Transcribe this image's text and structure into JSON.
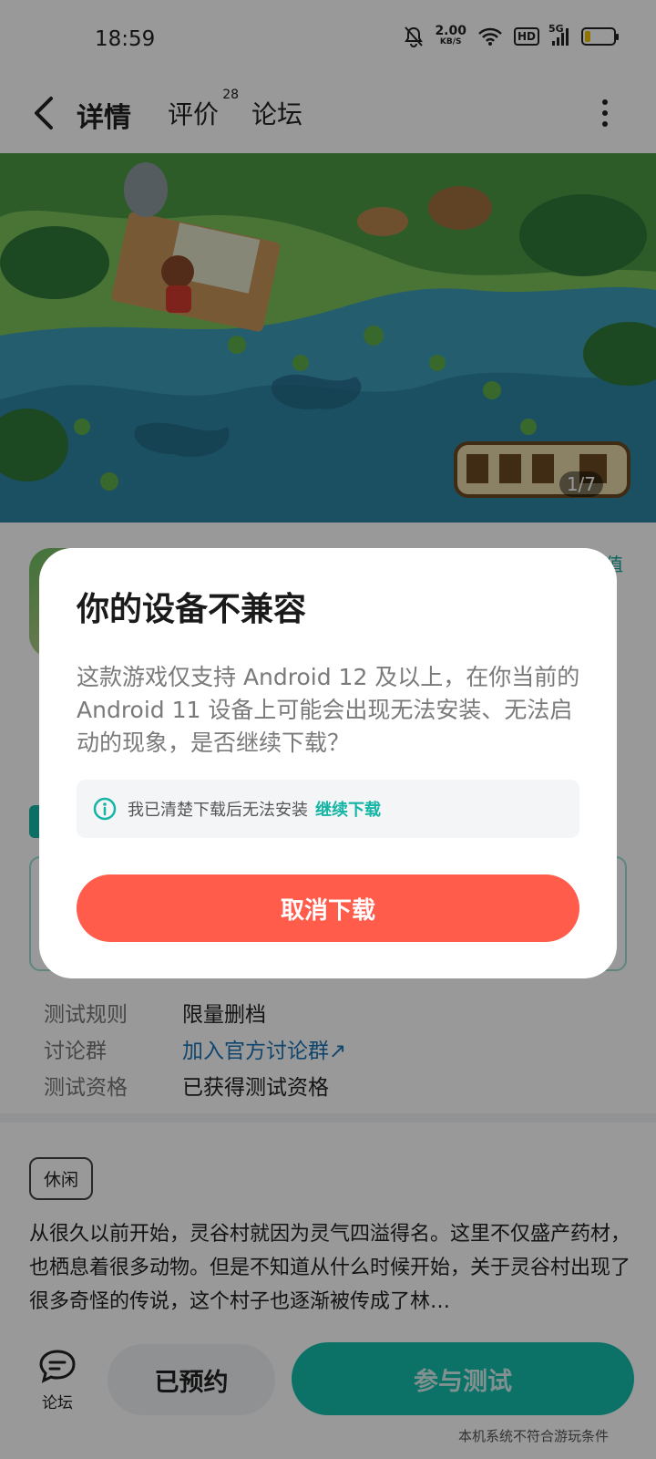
{
  "status_bar": {
    "time": "18:59",
    "net_speed": "2.00",
    "net_unit": "KB/S",
    "hd": "HD",
    "signal": "5G"
  },
  "nav": {
    "tabs": [
      {
        "label": "详情",
        "active": true
      },
      {
        "label": "评价",
        "badge": "28"
      },
      {
        "label": "论坛"
      }
    ]
  },
  "banner": {
    "counter": "1/7"
  },
  "page": {
    "rate_tag": "值",
    "info_rows": [
      {
        "key": "测试规则",
        "value": "限量删档"
      },
      {
        "key": "讨论群",
        "value": "加入官方讨论群↗"
      },
      {
        "key": "测试资格",
        "value": "已获得测试资格"
      }
    ],
    "genre_tag": "休闲",
    "description": "从很久以前开始，灵谷村就因为灵气四溢得名。这里不仅盛产药材，也栖息着很多动物。但是不知道从什么时候开始，关于灵谷村出现了很多奇怪的传说，这个村子也逐渐被传成了林…"
  },
  "bottom_bar": {
    "forum_label": "论坛",
    "reserved_label": "已预约",
    "join_test_label": "参与测试",
    "incompat_note": "本机系统不符合游玩条件"
  },
  "dialog": {
    "title": "你的设备不兼容",
    "message": "这款游戏仅支持 Android 12 及以上，在你当前的 Android 11 设备上可能会出现无法安装、无法启动的现象，是否继续下载？",
    "check_text": "我已清楚下载后无法安装",
    "continue_link": "继续下载",
    "cancel_button": "取消下载"
  },
  "colors": {
    "accent": "#14c1b2",
    "danger": "#ff5c4c",
    "link": "#1c73b8"
  }
}
